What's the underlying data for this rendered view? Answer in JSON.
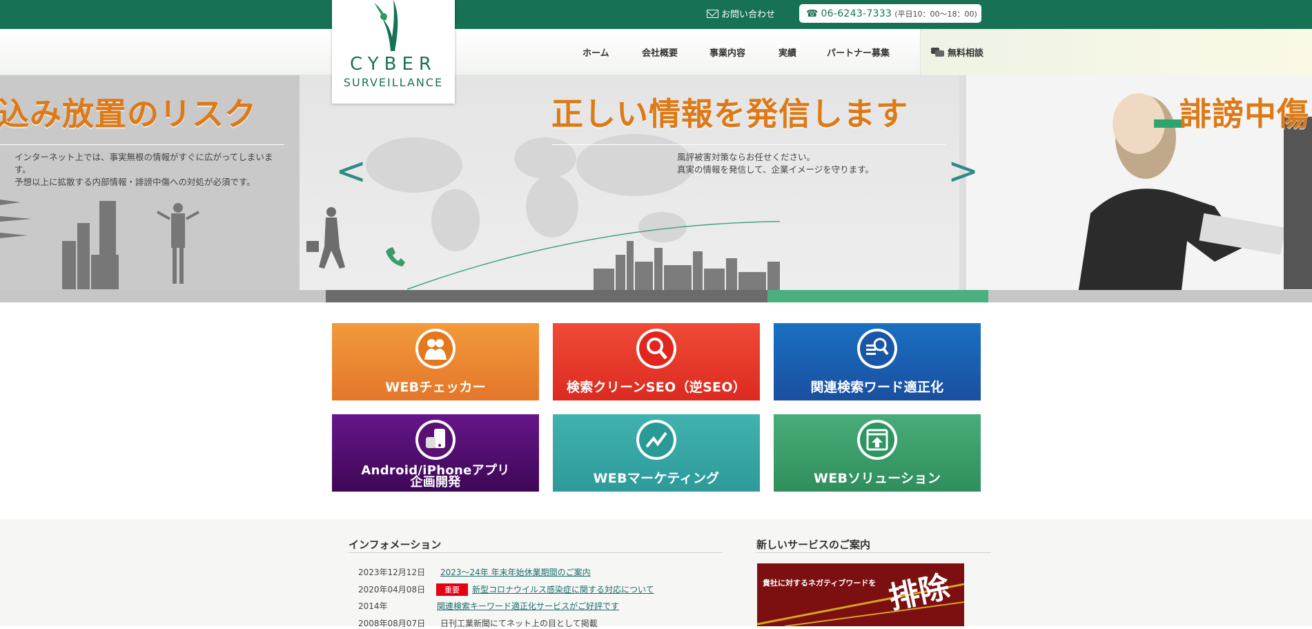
{
  "topbar": {
    "contact_label": "お問い合わせ",
    "phone": "06-6243-7333",
    "hours": "(平日10：00〜18：00)"
  },
  "logo": {
    "line1": "CYBER",
    "line2": "SURVEILLANCE"
  },
  "nav": {
    "items": [
      "ホーム",
      "会社概要",
      "事業内容",
      "実績",
      "パートナー募集"
    ],
    "consult_label": "無料相談"
  },
  "hero": {
    "left_title": "込み放置のリスク",
    "left_text": [
      "インターネット上では、事実無根の情報がすぐに広がってしまいま",
      "す。",
      "予想以上に拡散する内部情報・誹謗中傷への対処が必須です。"
    ],
    "center_title": "正しい情報を発信します",
    "center_text": [
      "風評被害対策ならお任せください。",
      "真実の情報を発信して、企業イメージを守ります。"
    ],
    "right_title": "誹謗中傷",
    "prev_arrow": "<",
    "next_arrow": ">"
  },
  "services": [
    {
      "label": "WEBチェッカー",
      "icon": "people-icon",
      "color": "#ee8a2c"
    },
    {
      "label": "検索クリーンSEO（逆SEO）",
      "icon": "magnifier-icon",
      "color": "#e8382a"
    },
    {
      "label": "関連検索ワード適正化",
      "icon": "search-list-icon",
      "color": "#1a5fb0"
    },
    {
      "label": "Android/iPhoneアプリ",
      "label2": "企画開発",
      "icon": "smartphone-icon",
      "color": "#5a0f74"
    },
    {
      "label": "WEBマーケティング",
      "icon": "trend-chart-icon",
      "color": "#35a6a6"
    },
    {
      "label": "WEBソリューション",
      "icon": "upload-window-icon",
      "color": "#3c9f6c"
    }
  ],
  "info": {
    "title": "インフォメーション",
    "items": [
      {
        "date": "2023年12月12日",
        "text": "2023～24年 年末年始休業期間のご案内",
        "link": true
      },
      {
        "date": "2020年04月08日",
        "badge": "重要",
        "text": "新型コロナウイルス感染症に関する対応について",
        "link": true
      },
      {
        "date": "2014年",
        "text": "関連検索キーワード適正化サービスがご好評です",
        "link": true
      },
      {
        "date": "2008年08月07日",
        "text": "日刊工業新聞にてネット上の目として掲載",
        "link": false
      }
    ]
  },
  "new_service": {
    "title": "新しいサービスのご案内",
    "banner_text": "貴社に対するネガティブワードを",
    "banner_big": "排除"
  }
}
